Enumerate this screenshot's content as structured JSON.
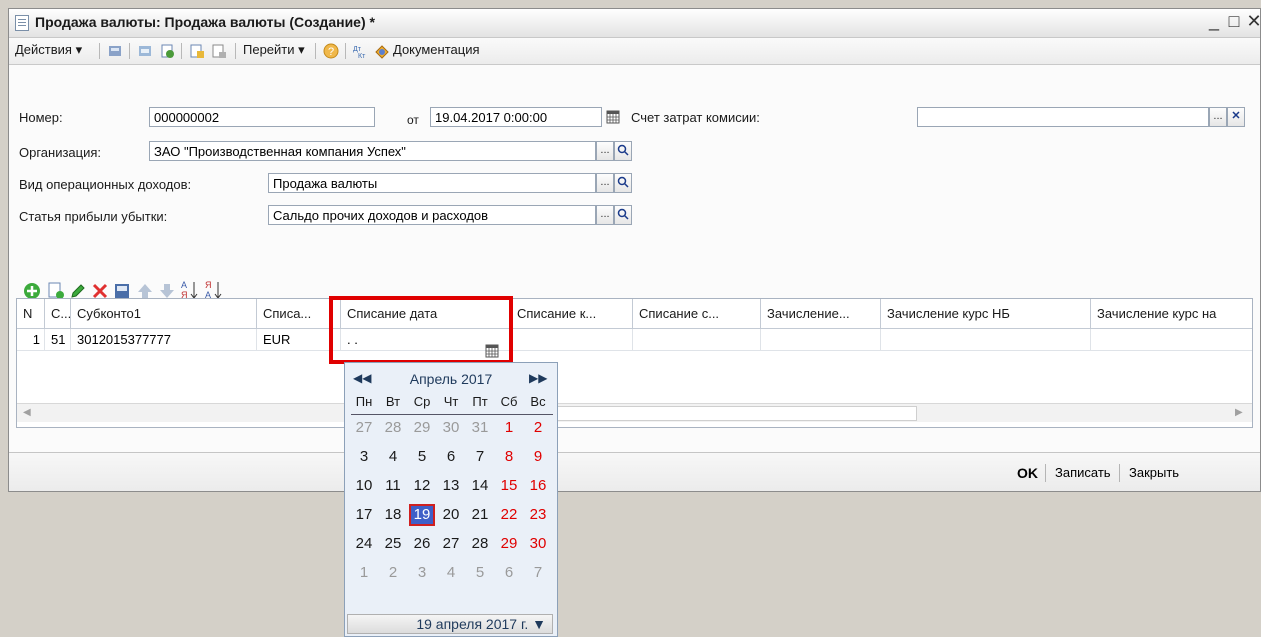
{
  "window": {
    "title": "Продажа валюты: Продажа валюты (Создание) *",
    "minimize": "_",
    "maximize": "□",
    "close": "✕"
  },
  "toolbar": {
    "actions_label": "Действия ▾",
    "goto_label": "Перейти ▾",
    "docs_label": "Документация"
  },
  "form": {
    "number_label": "Номер:",
    "number_value": "000000002",
    "date_from_label": "от",
    "date_value": "19.04.2017  0:00:00",
    "expense_account_label": "Счет затрат комисии:",
    "expense_account_value": "",
    "organization_label": "Организация:",
    "organization_value": "ЗАО \"Производственная компания Успех\"",
    "income_type_label": "Вид операционных доходов:",
    "income_type_value": "Продажа валюты",
    "profit_item_label": "Статья прибыли убытки:",
    "profit_item_value": "Сальдо прочих доходов и расходов"
  },
  "table": {
    "columns": [
      "N",
      "С...",
      "Субконто1",
      "Списа...",
      "Списание дата",
      "Списание к...",
      "Списание с...",
      "Зачисление...",
      "Зачисление курс НБ",
      "Зачисление курс на"
    ],
    "row": [
      "1",
      "51",
      "3012015377777",
      "EUR",
      ". .",
      "",
      "",
      "",
      "",
      ""
    ]
  },
  "calendar": {
    "month_label": "Апрель 2017",
    "weekdays": [
      "Пн",
      "Вт",
      "Ср",
      "Чт",
      "Пт",
      "Сб",
      "Вс"
    ],
    "weeks": [
      [
        "27",
        "28",
        "29",
        "30",
        "31",
        "1",
        "2"
      ],
      [
        "3",
        "4",
        "5",
        "6",
        "7",
        "8",
        "9"
      ],
      [
        "10",
        "11",
        "12",
        "13",
        "14",
        "15",
        "16"
      ],
      [
        "17",
        "18",
        "19",
        "20",
        "21",
        "22",
        "23"
      ],
      [
        "24",
        "25",
        "26",
        "27",
        "28",
        "29",
        "30"
      ],
      [
        "1",
        "2",
        "3",
        "4",
        "5",
        "6",
        "7"
      ]
    ],
    "selected": "19",
    "today_label": "19 апреля 2017 г. ▼"
  },
  "footer": {
    "ok_label": "OK",
    "save_label": "Записать",
    "close_label": "Закрыть"
  },
  "colors": {
    "highlight_border": "#e00000",
    "weekend": "#e00000",
    "selected_day_bg": "#3f5fc8"
  }
}
